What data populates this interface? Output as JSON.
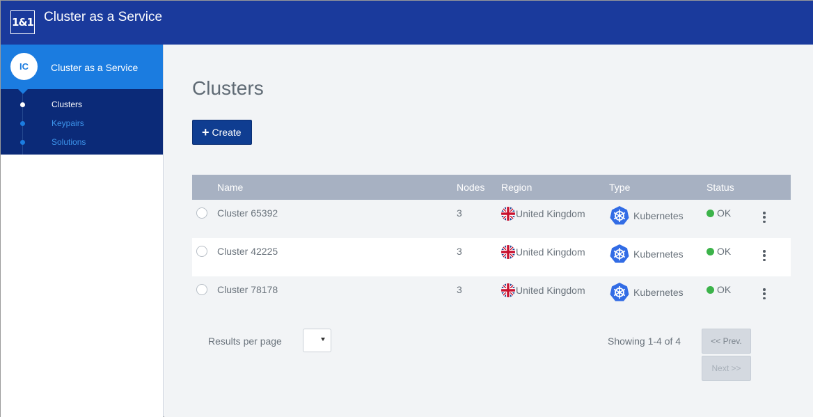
{
  "header": {
    "logo_text": "1&1",
    "app_title": "Cluster as a Service",
    "bg_color": "#1a3a9c"
  },
  "sidebar": {
    "avatar_initials": "IC",
    "title": "Cluster as a Service",
    "accent_color": "#1b7ce0",
    "items": [
      {
        "label": "Clusters",
        "active": true
      },
      {
        "label": "Keypairs",
        "active": false
      },
      {
        "label": "Solutions",
        "active": false
      }
    ]
  },
  "main": {
    "page_title": "Clusters",
    "create_label": "Create",
    "create_icon": "plus-icon",
    "table": {
      "headers": {
        "name": "Name",
        "nodes": "Nodes",
        "region": "Region",
        "type": "Type",
        "status": "Status"
      },
      "rows": [
        {
          "name": "Cluster 65392",
          "nodes": "3",
          "region": "United Kingdom",
          "region_icon": "uk-flag-icon",
          "type": "Kubernetes",
          "type_icon": "kubernetes-icon",
          "status": "OK",
          "status_color": "#3cb34a"
        },
        {
          "name": "Cluster 42225",
          "nodes": "3",
          "region": "United Kingdom",
          "region_icon": "uk-flag-icon",
          "type": "Kubernetes",
          "type_icon": "kubernetes-icon",
          "status": "OK",
          "status_color": "#3cb34a"
        },
        {
          "name": "Cluster 78178",
          "nodes": "3",
          "region": "United Kingdom",
          "region_icon": "uk-flag-icon",
          "type": "Kubernetes",
          "type_icon": "kubernetes-icon",
          "status": "OK",
          "status_color": "#3cb34a"
        }
      ]
    },
    "pagination": {
      "results_per_page_label": "Results per page",
      "results_per_page_value": "",
      "showing": "Showing 1-4 of 4",
      "prev_label": "<< Prev.",
      "next_label": "Next >>"
    }
  }
}
